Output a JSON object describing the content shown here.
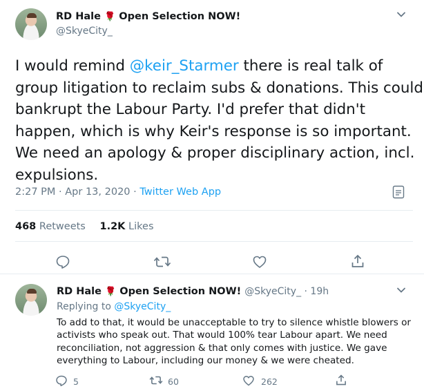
{
  "tweet": {
    "author_name": "RD Hale",
    "name_suffix": "Open Selection NOW!",
    "rose_glyph": "🌹",
    "handle": "@SkyeCity_",
    "lines": [
      {
        "pre": "I would remind ",
        "mention": "@keir_Starmer",
        "post": " there is real talk of"
      },
      {
        "text": "group litigation to reclaim subs & donations. This could"
      },
      {
        "text": "bankrupt the Labour Party. I'd prefer that didn't"
      },
      {
        "text": "happen, which is why Keir's response is so important."
      },
      {
        "text": "We need an apology & proper disciplinary action, incl."
      },
      {
        "text": "expulsions."
      }
    ],
    "time": "2:27 PM · Apr 13, 2020 · ",
    "source": "Twitter Web App",
    "retweets_count": "468",
    "retweets_label": "Retweets",
    "likes_count": "1.2K",
    "likes_label": "Likes"
  },
  "reply": {
    "author_name": "RD Hale",
    "name_suffix": "Open Selection NOW!",
    "handle_time": "@SkyeCity_ · 19h",
    "replying_to": "Replying to ",
    "replying_handle": "@SkyeCity_",
    "lines": [
      "To add to that, it would be unacceptable to try to silence whistle blowers or",
      "activists who speak out. That would 100% tear Labour apart. We need",
      "reconciliation, not aggression & that only comes with justice. We gave",
      "everything to Labour, including our money & we were cheated."
    ],
    "reply_count": "5",
    "retweet_count": "60",
    "like_count": "262"
  },
  "colors": {
    "accent": "#1da1f2",
    "muted": "#657786",
    "text": "#14171a",
    "rose": "#c0162b"
  },
  "icons": [
    "chevron-down-icon",
    "analytics-icon",
    "reply-icon",
    "retweet-icon",
    "like-icon",
    "share-icon"
  ]
}
